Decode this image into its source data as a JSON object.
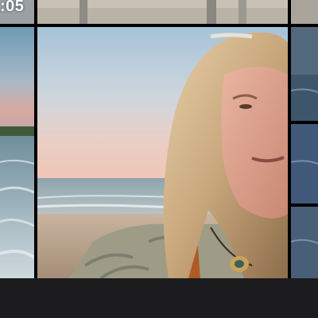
{
  "grid": {
    "top_row": {
      "duration_label": ":05"
    },
    "tiles": [
      {
        "kind": "beach-video-thumbnail"
      },
      {
        "kind": "beach-shore-photo"
      },
      {
        "kind": "beach-selfie-photo"
      },
      {
        "kind": "ocean-blue-photos"
      }
    ]
  },
  "colors": {
    "background": "#000000",
    "bottom_bar": "#1c1c1e"
  }
}
